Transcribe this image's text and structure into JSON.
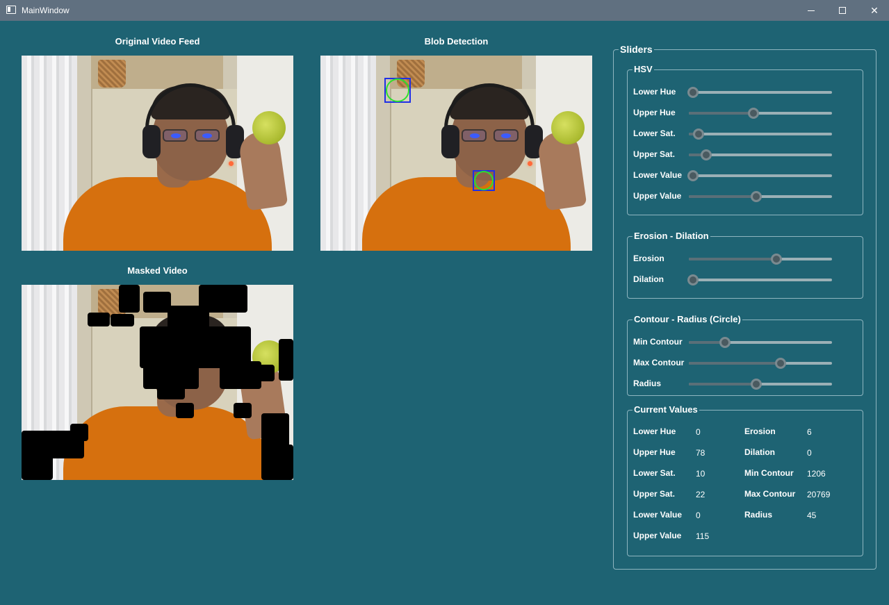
{
  "window": {
    "title": "MainWindow"
  },
  "videos": {
    "original": {
      "title": "Original Video Feed"
    },
    "blob": {
      "title": "Blob Detection"
    },
    "masked": {
      "title": "Masked Video"
    }
  },
  "sliders": {
    "title": "Sliders",
    "hsv": {
      "title": "HSV",
      "items": [
        {
          "label": "Lower Hue",
          "level": 0.03
        },
        {
          "label": "Upper Hue",
          "level": 0.45
        },
        {
          "label": "Lower Sat.",
          "level": 0.07
        },
        {
          "label": "Upper Sat.",
          "level": 0.12
        },
        {
          "label": "Lower Value",
          "level": 0.03
        },
        {
          "label": "Upper Value",
          "level": 0.47
        }
      ]
    },
    "erosion_dilation": {
      "title": "Erosion - Dilation",
      "items": [
        {
          "label": "Erosion",
          "level": 0.61
        },
        {
          "label": "Dilation",
          "level": 0.03
        }
      ]
    },
    "contour": {
      "title": "Contour - Radius (Circle)",
      "items": [
        {
          "label": "Min Contour",
          "level": 0.25
        },
        {
          "label": "Max Contour",
          "level": 0.64
        },
        {
          "label": "Radius",
          "level": 0.47
        }
      ]
    },
    "current_values": {
      "title": "Current Values",
      "left": [
        {
          "label": "Lower Hue",
          "value": "0"
        },
        {
          "label": "Upper Hue",
          "value": "78"
        },
        {
          "label": "Lower Sat.",
          "value": "10"
        },
        {
          "label": "Upper Sat.",
          "value": "22"
        },
        {
          "label": "Lower Value",
          "value": "0"
        },
        {
          "label": "Upper Value",
          "value": "115"
        }
      ],
      "right": [
        {
          "label": "Erosion",
          "value": "6"
        },
        {
          "label": "Dilation",
          "value": "0"
        },
        {
          "label": "Min Contour",
          "value": "1206"
        },
        {
          "label": "Max Contour",
          "value": "20769"
        },
        {
          "label": "Radius",
          "value": "45"
        }
      ]
    }
  },
  "colors": {
    "background": "#1e6373",
    "titlebar": "#607080",
    "detection_box": "#1f2fe6",
    "detection_circle": "#2de02d"
  }
}
